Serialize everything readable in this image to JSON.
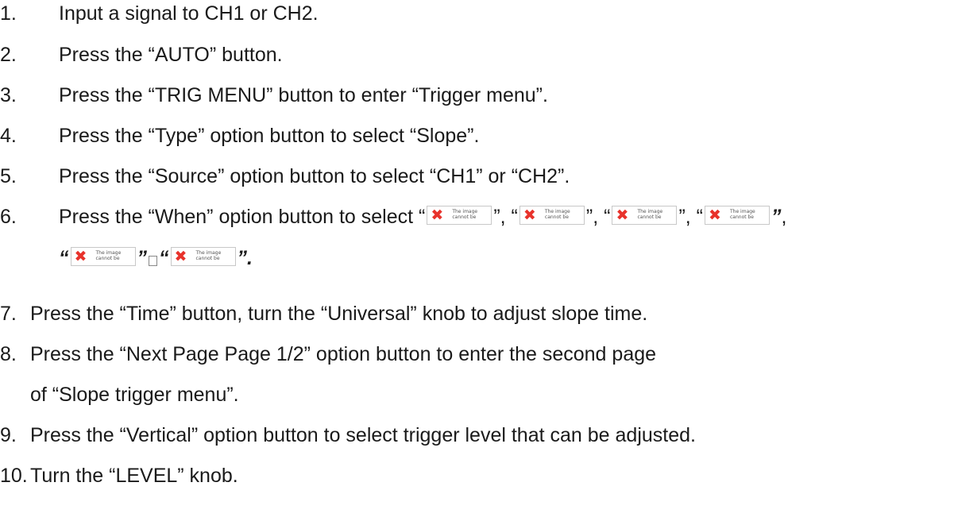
{
  "steps": [
    {
      "num": "1.",
      "text": "Input a signal to CH1 or CH2."
    },
    {
      "num": "2.",
      "text": "Press the “AUTO” button."
    },
    {
      "num": "3.",
      "text": "Press the “TRIG MENU” button to enter “Trigger menu”."
    },
    {
      "num": "4.",
      "text": "Press the “Type” option button to select “Slope”."
    },
    {
      "num": "5.",
      "text": "Press the “Source” option button to select “CH1” or “CH2”."
    },
    {
      "num": "6.",
      "text": "Press the “When” option button to select “"
    },
    {
      "num": "7.",
      "text": "Press the “Time” button, turn the “Universal” knob to adjust slope time."
    },
    {
      "num": "8.",
      "text": "Press the “Next Page  Page 1/2” option button to enter the second page",
      "cont": "of “Slope trigger menu”."
    },
    {
      "num": "9.",
      "text": "Press the “Vertical” option button to select trigger level that can be adjusted."
    },
    {
      "num": "10.",
      "text": "Turn the “LEVEL” knob."
    }
  ],
  "step6": {
    "sep_close_open": "”, “",
    "sep_close_comma": "”,",
    "bold_open": "“",
    "bold_close": "”",
    "bold_close_period": "”.",
    "missing_image_caption": "The image cannot be"
  }
}
